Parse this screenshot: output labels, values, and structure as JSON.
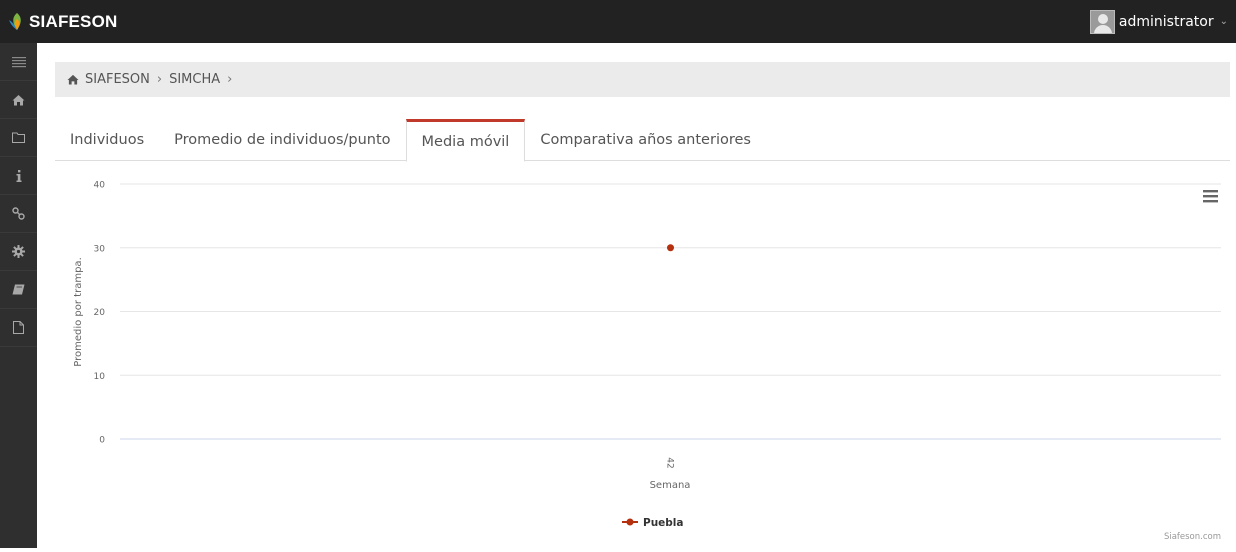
{
  "app": {
    "brand": "SIAFESON",
    "user": "administrator",
    "accent_color": "#c0392b"
  },
  "sidebar": {
    "items": [
      {
        "icon": "menu-icon"
      },
      {
        "icon": "home-icon"
      },
      {
        "icon": "folder-icon"
      },
      {
        "icon": "info-icon"
      },
      {
        "icon": "link-icon"
      },
      {
        "icon": "gear-icon"
      },
      {
        "icon": "book-icon"
      },
      {
        "icon": "file-icon"
      }
    ]
  },
  "breadcrumb": {
    "items": [
      "SIAFESON",
      "SIMCHA"
    ]
  },
  "tabs": [
    {
      "label": "Individuos",
      "active": false
    },
    {
      "label": "Promedio de individuos/punto",
      "active": false
    },
    {
      "label": "Media móvil",
      "active": true
    },
    {
      "label": "Comparativa años anteriores",
      "active": false
    }
  ],
  "chart_data": {
    "type": "line",
    "xlabel": "Semana",
    "ylabel": "Promedio por trampa.",
    "ylim": [
      0,
      40
    ],
    "yticks": [
      "0",
      "10",
      "20",
      "30",
      "40"
    ],
    "categories": [
      "42"
    ],
    "series": [
      {
        "name": "Puebla",
        "values": [
          30
        ],
        "color": "#b5300e"
      }
    ],
    "grid": true,
    "legend": "bottom-center",
    "credits": "Siafeson.com"
  }
}
